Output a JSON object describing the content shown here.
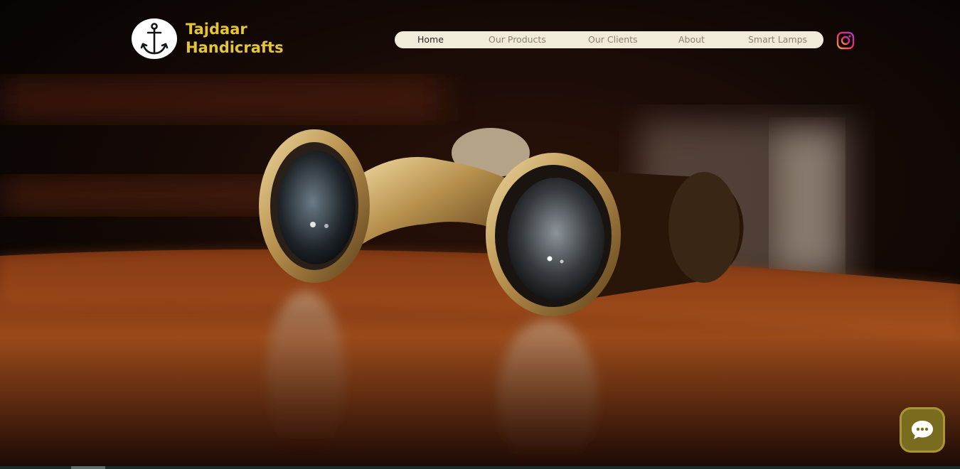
{
  "brand": {
    "line1": "Tajdaar",
    "line2": "Handicrafts",
    "logo_icon": "anchor-icon",
    "color": "#e6c535"
  },
  "nav": {
    "items": [
      {
        "label": "Home",
        "active": true
      },
      {
        "label": "Our Products",
        "active": false
      },
      {
        "label": "Our Clients",
        "active": false
      },
      {
        "label": "About",
        "active": false
      },
      {
        "label": "Smart Lamps",
        "active": false
      }
    ],
    "background": "#f1ebdb"
  },
  "social": {
    "icon": "instagram-icon"
  },
  "chat": {
    "icon": "chat-bubble-icon",
    "color": "#7a6c1e"
  },
  "hero": {
    "subject": "binoculars-photo"
  }
}
